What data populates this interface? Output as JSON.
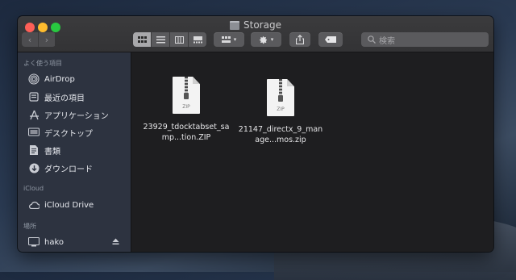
{
  "window": {
    "title": "Storage"
  },
  "toolbar": {
    "back_label": "‹",
    "forward_label": "›",
    "search_placeholder": "検索"
  },
  "sidebar": {
    "favorites_header": "よく使う項目",
    "favorites": [
      {
        "label": "AirDrop",
        "icon": "airdrop-icon"
      },
      {
        "label": "最近の項目",
        "icon": "recents-icon"
      },
      {
        "label": "アプリケーション",
        "icon": "applications-icon"
      },
      {
        "label": "デスクトップ",
        "icon": "desktop-icon"
      },
      {
        "label": "書類",
        "icon": "documents-icon"
      },
      {
        "label": "ダウンロード",
        "icon": "downloads-icon"
      }
    ],
    "icloud_header": "iCloud",
    "icloud": [
      {
        "label": "iCloud Drive",
        "icon": "cloud-icon"
      }
    ],
    "locations_header": "場所",
    "locations": [
      {
        "label": "hako",
        "icon": "disk-icon"
      }
    ]
  },
  "files": [
    {
      "name": "23929_tdocktabset_samp...tion.ZIP",
      "ext": "ZIP",
      "icon": "zip-file-icon"
    },
    {
      "name": "21147_directx_9_manage...mos.zip",
      "ext": "ZIP",
      "icon": "zip-file-icon"
    }
  ],
  "colors": {
    "sidebar_bg": "#2d3340",
    "content_bg": "#1e1e20",
    "titlebar_bg": "#363638",
    "close": "#fe5f57",
    "minimize": "#febc2e",
    "maximize": "#28c840"
  }
}
